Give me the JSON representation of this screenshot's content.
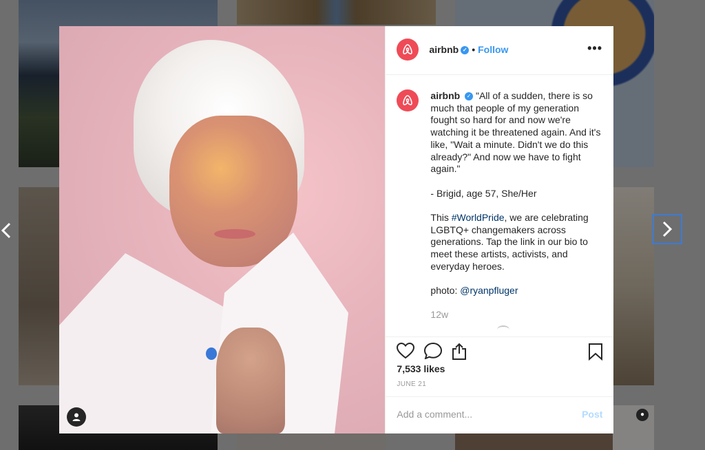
{
  "post": {
    "username": "airbnb",
    "follow_label": "Follow",
    "separator": "•",
    "more_label": "•••",
    "caption_quote": "\"All of a sudden, there is so much that people of my generation fought so hard for and now we're watching it be threatened again. And it's like, \"Wait a minute. Didn't we do this already?\" And now we have to fight again.\"",
    "attribution": "- Brigid, age 57, She/Her",
    "body_prefix": "This ",
    "hashtag": "#WorldPride",
    "body_suffix": ", we are celebrating LGBTQ+ changemakers across generations. Tap the link in our bio to meet these artists, activists, and everyday heroes.",
    "photo_credit_prefix": "photo: ",
    "photo_credit_handle": "@ryanpfluger",
    "time_ago": "12w",
    "likes": "7,533 likes",
    "date": "JUNE 21"
  },
  "comment": {
    "placeholder": "Add a comment...",
    "post_label": "Post"
  },
  "nav": {
    "prev_glyph": "‹",
    "next_glyph": "›"
  },
  "colors": {
    "brand": "#ef4b57",
    "link": "#3897f0",
    "hashtag": "#003569",
    "post_disabled": "#b3dbff"
  },
  "icons": {
    "verified": "verified-badge-icon",
    "like": "heart-icon",
    "comment": "comment-icon",
    "share": "share-icon",
    "save": "bookmark-icon",
    "user_tag": "user-tag-icon",
    "brand_logo": "airbnb-logo-icon"
  }
}
